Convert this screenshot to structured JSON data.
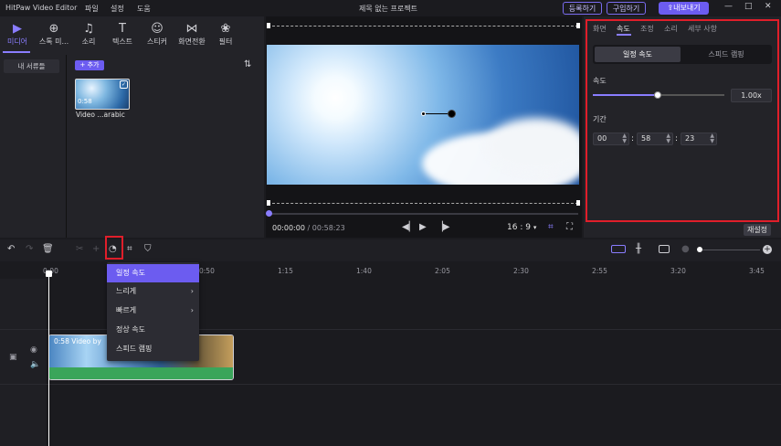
{
  "app": {
    "name": "HitPaw Video Editor",
    "project_title": "제목 없는 프로젝트"
  },
  "menu": [
    "파일",
    "설정",
    "도움"
  ],
  "header_buttons": {
    "register": "등록하기",
    "buy": "구입하기",
    "export": "내보내기"
  },
  "window_controls": {
    "minimize": "—",
    "maximize": "□",
    "close": "✕"
  },
  "tools": [
    {
      "label": "미디어",
      "icon": "▶",
      "name": "media"
    },
    {
      "label": "스톡 미...",
      "icon": "⊕",
      "name": "stock-media"
    },
    {
      "label": "소리",
      "icon": "♫",
      "name": "sound"
    },
    {
      "label": "텍스트",
      "icon": "T",
      "name": "text"
    },
    {
      "label": "스티커",
      "icon": "☺",
      "name": "sticker"
    },
    {
      "label": "화면전환",
      "icon": "⋈",
      "name": "transition"
    },
    {
      "label": "필터",
      "icon": "❀",
      "name": "filter"
    }
  ],
  "library": {
    "my_library": "내 서류들",
    "add": "+ 추가",
    "sort_icon": "⇅"
  },
  "media_clip": {
    "duration": "0:58",
    "name": "Video ...arabic",
    "check": "✓"
  },
  "player": {
    "current": "00:00:00",
    "total": "/ 00:58:23",
    "ratio": "16 : 9",
    "ratio_arrow": "▾",
    "prev": "◀▏",
    "play": "▶",
    "next": "▕▶",
    "crop_icon": "⌗",
    "fullscreen_icon": "⛶"
  },
  "right_tabs": [
    "화면",
    "속도",
    "조정",
    "소리",
    "세부 사항"
  ],
  "speed_panel": {
    "segment_uniform": "일정 속도",
    "segment_ramp": "스피드 램핑",
    "speed_label": "속도",
    "speed_value": "1.00x",
    "speed_fraction": 0.49,
    "duration_label": "기간",
    "duration": [
      "00",
      "58",
      "23"
    ],
    "colon": ":",
    "reset": "재설정"
  },
  "timeline_toolbar": {
    "undo": "↶",
    "redo": "↷",
    "delete": "🗑",
    "split": "✂",
    "speed": "◔",
    "crop": "⌗",
    "mark": "⛉",
    "zoom_out": "●",
    "zoom_in": "+"
  },
  "ruler": [
    "0:00",
    "0:50",
    "1:15",
    "1:40",
    "2:05",
    "2:30",
    "2:55",
    "3:20",
    "3:45"
  ],
  "track": {
    "clip_label": "0:58  Video by",
    "eye": "◉",
    "mute": "🔈",
    "lock": "▣"
  },
  "dropdown": [
    {
      "label": "일정 속도",
      "submenu": false
    },
    {
      "label": "느리게",
      "submenu": true
    },
    {
      "label": "빠르게",
      "submenu": true
    },
    {
      "label": "정상 속도",
      "submenu": false
    },
    {
      "label": "스피드 램핑",
      "submenu": false
    }
  ],
  "dropdown_arrow": "›",
  "colors": {
    "accent": "#6c5cf0",
    "highlight": "#e01e2a",
    "bg": "#1b1b1f",
    "panel": "#232328"
  }
}
